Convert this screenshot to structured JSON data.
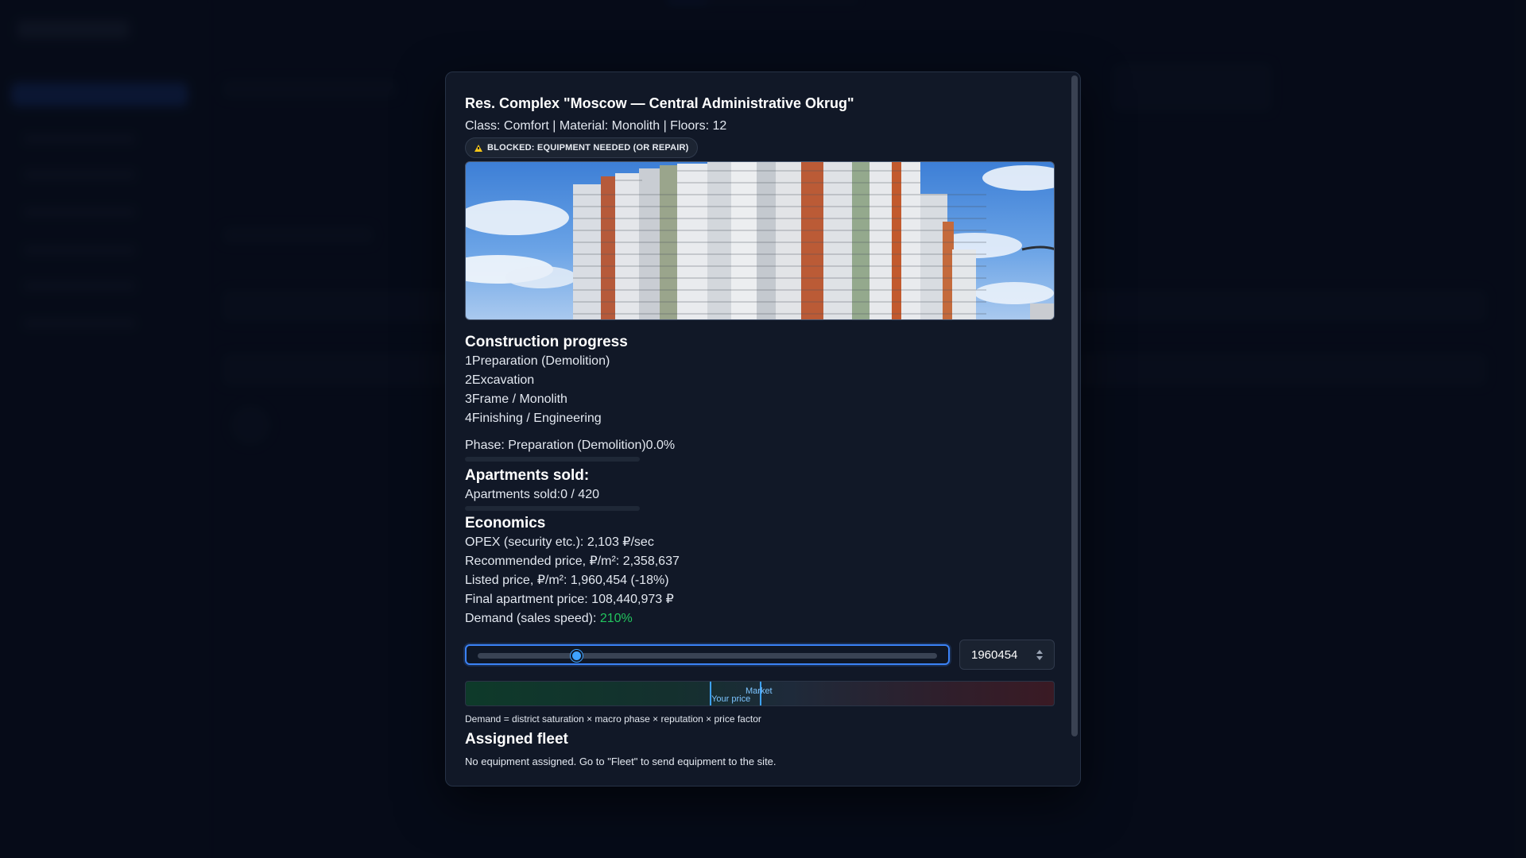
{
  "modal": {
    "title": "Res. Complex \"Moscow — Central Administrative Okrug\"",
    "subtitle": "Class: Comfort | Material: Monolith | Floors: 12",
    "badge": "BLOCKED: EQUIPMENT NEEDED (OR REPAIR)",
    "badge_icon": "warning-icon",
    "hero_image": "apartment-towers-image"
  },
  "progress": {
    "heading": "Construction progress",
    "stages": [
      "1Preparation (Demolition)",
      "2Excavation",
      "3Frame / Monolith",
      "4Finishing / Engineering"
    ],
    "phase_label": "Phase: Preparation (Demolition)",
    "phase_value": "0.0%",
    "phase_fraction": 0.0
  },
  "sales": {
    "heading": "Apartments sold:",
    "label": "Apartments sold:",
    "value": "0 / 420",
    "fraction": 0.0
  },
  "economics": {
    "heading": "Economics",
    "opex": "OPEX (security etc.): 2,103 ₽/sec",
    "recommended": "Recommended price, ₽/m²: 2,358,637",
    "listed": "Listed price, ₽/m²: 1,960,454 (-18%)",
    "final": "Final apartment price: 108,440,973 ₽",
    "demand_label": "Demand (sales speed): ",
    "demand_value": "210%"
  },
  "price_control": {
    "slider_fraction": 0.215,
    "input_value": "1960454",
    "your_price_label": "Your price",
    "market_label": "Market",
    "your_price_fraction": 0.415,
    "market_fraction": 0.5
  },
  "formula": "Demand = district saturation × macro phase × reputation × price factor",
  "fleet": {
    "heading": "Assigned fleet",
    "text": "No equipment assigned. Go to \"Fleet\" to send equipment to the site."
  },
  "colors": {
    "accent": "#3b82f6",
    "demand_positive": "#22c55e",
    "warning": "#f5c518"
  }
}
